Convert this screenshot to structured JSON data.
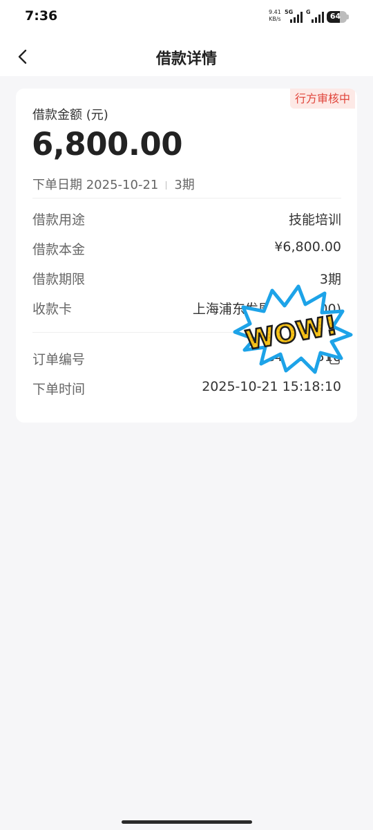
{
  "status_bar": {
    "time": "7:36",
    "net_speed_value": "9.41",
    "net_speed_unit": "KB/s",
    "sim1_gen": "5G",
    "sim2_gen": "G",
    "battery_level": "64"
  },
  "nav": {
    "title": "借款详情",
    "back_icon": "chevron-left-icon"
  },
  "loan": {
    "status_badge": "行方审核中",
    "amount_label": "借款金额 (元)",
    "amount": "6,800.00",
    "order_date_label": "下单日期",
    "order_date": "2025-10-21",
    "term_short": "3期",
    "details": [
      {
        "key": "借款用途",
        "value": "技能培训"
      },
      {
        "key": "借款本金",
        "value": "¥6,800.00"
      },
      {
        "key": "借款期限",
        "value": "3期"
      },
      {
        "key": "收款卡",
        "value": "上海浦东发展银行(8800)"
      }
    ],
    "order_no_label": "订单编号",
    "order_no": "C48122510",
    "order_time_label": "下单时间",
    "order_time": "2025-10-21 15:18:10"
  },
  "sticker": {
    "text": "WOW!",
    "colors": {
      "outline": "#1da3e8",
      "fill": "#f5c518",
      "dots": "#e8a214"
    }
  },
  "colors": {
    "badge_text": "#e0443a",
    "badge_bg": "#fde9e6",
    "page_bg": "#f6f6f8"
  }
}
